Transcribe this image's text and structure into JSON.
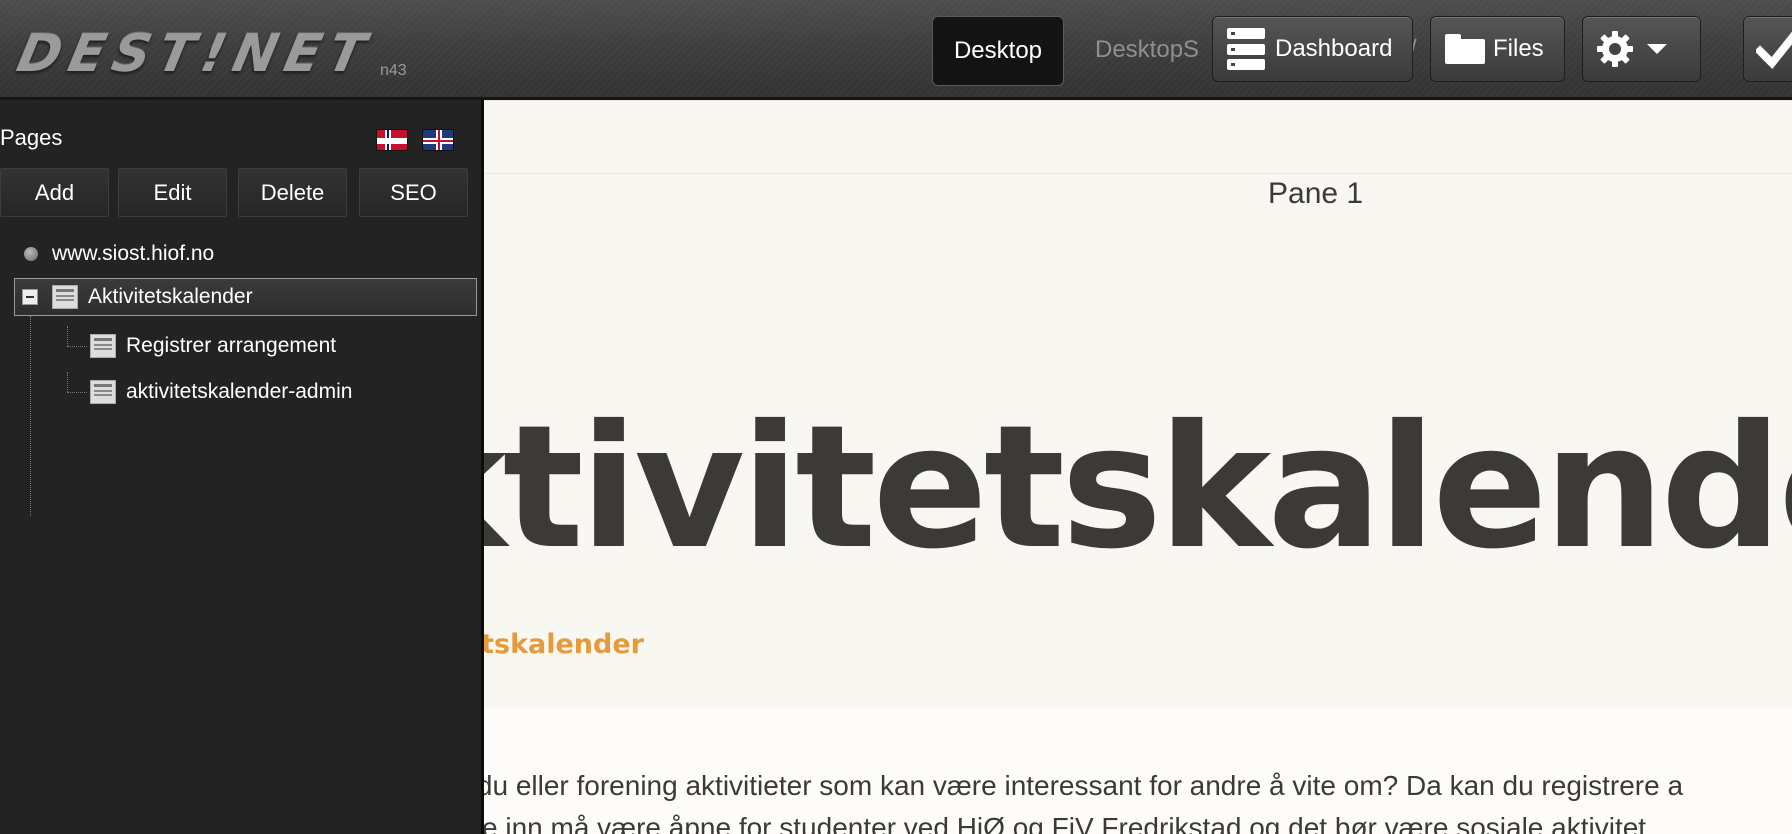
{
  "topbar": {
    "logo_text": "DEST!NET",
    "logo_sub": "n43",
    "desktop_button": "Desktop",
    "desktops_link": "DesktopS",
    "separator": "/",
    "dashboard_button": "Dashboard",
    "files_button": "Files"
  },
  "sidebar": {
    "title": "Pages",
    "languages": [
      "Norwegian",
      "English"
    ],
    "buttons": {
      "add": "Add",
      "edit": "Edit",
      "delete": "Delete",
      "seo": "SEO"
    },
    "tree": [
      {
        "label": "www.siost.hiof.no",
        "level": 0
      },
      {
        "label": "Aktivitetskalender",
        "level": 1,
        "selected": true,
        "expanded": true
      },
      {
        "label": "Registrer arrangement",
        "level": 2
      },
      {
        "label": "aktivitetskalender-admin",
        "level": 2
      }
    ]
  },
  "content": {
    "pane_label": "Pane 1",
    "hero_title": "Aktivitetskalender",
    "hero_subtitle": "Aktivitetskalender",
    "paragraph_line1": "Har du eller forening aktivitieter som kan være interessant for andre å vite om? Da kan du registrere a",
    "paragraph_line2": "e inn må være åpne for studenter ved HiØ og FiV Fredrikstad og det bør være sosiale aktivitet"
  },
  "colors": {
    "topbar": "#3f3f3f",
    "sidebar": "#232323",
    "content_bg": "#f9f7f2",
    "title_text": "#3b3a36",
    "accent_orange": "#e59a3c"
  }
}
